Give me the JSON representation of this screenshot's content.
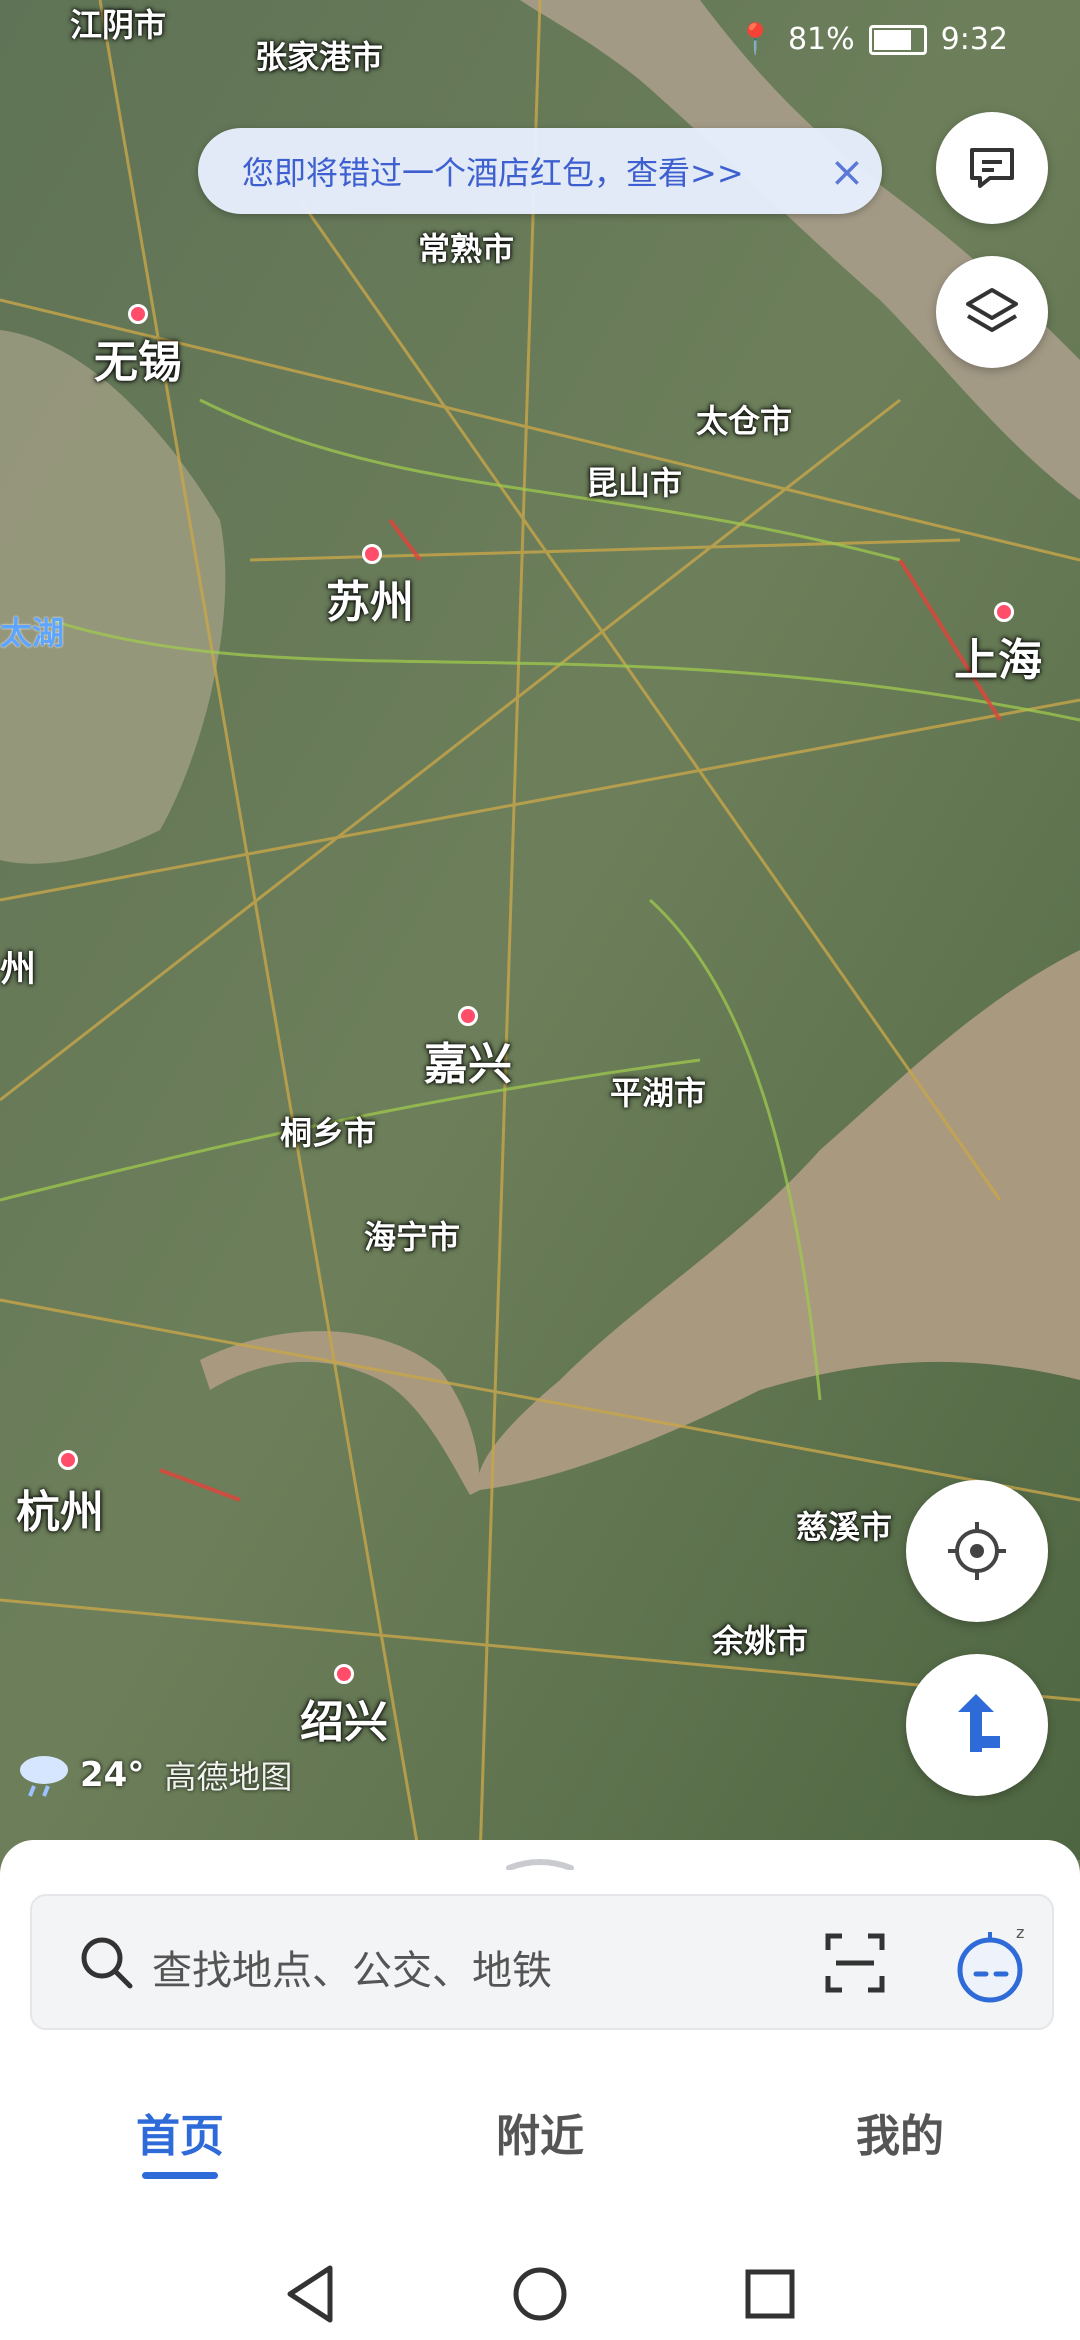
{
  "status_bar": {
    "left_city": "江阴市",
    "battery": "81%",
    "battery_level": 0.81,
    "time": "9:32"
  },
  "banner": {
    "text": "您即将错过一个酒店红包，查看>>",
    "close": "×"
  },
  "map": {
    "cities_big": [
      "苏州",
      "上海",
      "嘉兴",
      "杭州",
      "无锡",
      "绍兴"
    ],
    "cities_mid": [
      "张家港市",
      "常熟市",
      "太仓市",
      "昆山市",
      "平湖市",
      "桐乡市",
      "海宁市",
      "慈溪市",
      "余姚市"
    ],
    "water": "太湖",
    "edge_label": "州"
  },
  "weather": {
    "temperature": "24°",
    "brand": "高德地图"
  },
  "search": {
    "placeholder": "查找地点、公交、地铁"
  },
  "tabs": [
    {
      "label": "首页",
      "active": true
    },
    {
      "label": "附近",
      "active": false
    },
    {
      "label": "我的",
      "active": false
    }
  ],
  "colors": {
    "accent": "#2f6bd8",
    "banner_text": "#3d5fd0"
  }
}
